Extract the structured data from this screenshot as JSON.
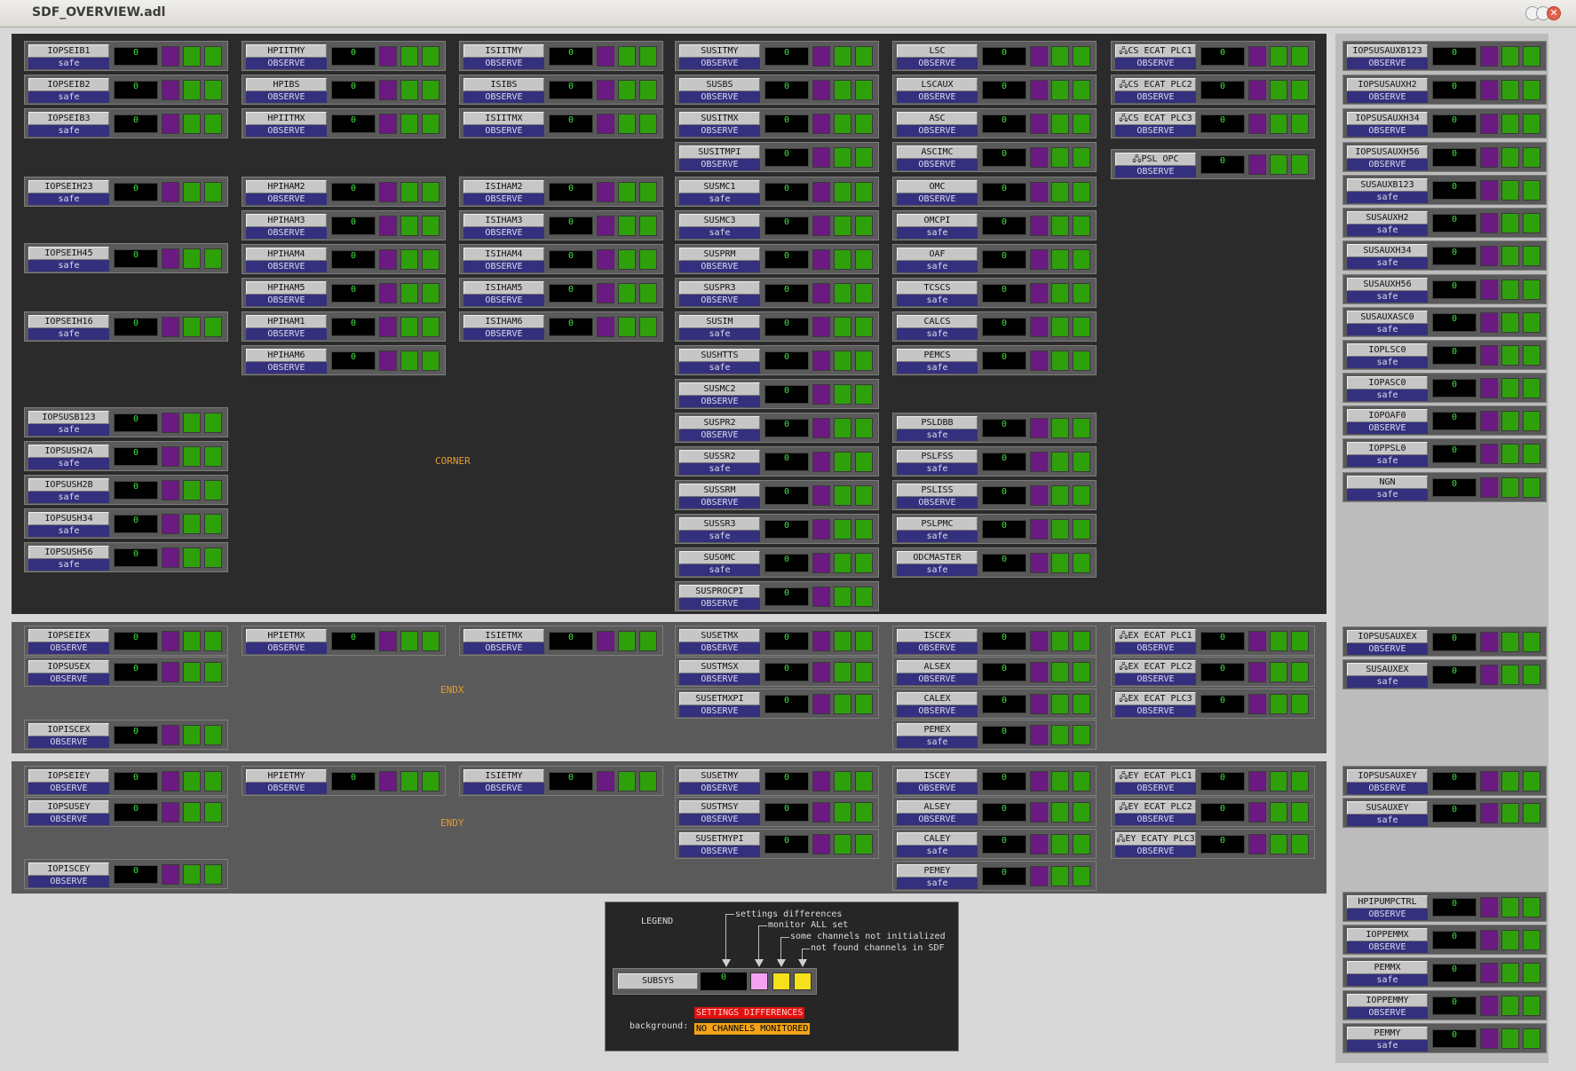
{
  "window": {
    "title": "SDF_OVERVIEW.adl"
  },
  "colors": {
    "purple": "#6b1a82",
    "green": "#2ea10a",
    "status_bg": "#34307e",
    "count_text": "#3fe33f"
  },
  "panels": {
    "corner": "CORNER",
    "endx": "ENDX",
    "endy": "ENDY"
  },
  "entries": [
    {
      "name": "IOPSEIB1",
      "status": "safe",
      "count": "0"
    },
    {
      "name": "IOPSEIB2",
      "status": "safe",
      "count": "0"
    },
    {
      "name": "IOPSEIB3",
      "status": "safe",
      "count": "0"
    },
    {
      "name": "IOPSEIH23",
      "status": "safe",
      "count": "0"
    },
    {
      "name": "IOPSEIH45",
      "status": "safe",
      "count": "0"
    },
    {
      "name": "IOPSEIH16",
      "status": "safe",
      "count": "0"
    },
    {
      "name": "IOPSUSB123",
      "status": "safe",
      "count": "0"
    },
    {
      "name": "IOPSUSH2A",
      "status": "safe",
      "count": "0"
    },
    {
      "name": "IOPSUSH2B",
      "status": "safe",
      "count": "0"
    },
    {
      "name": "IOPSUSH34",
      "status": "safe",
      "count": "0"
    },
    {
      "name": "IOPSUSH56",
      "status": "safe",
      "count": "0"
    },
    {
      "name": "HPIITMY",
      "status": "OBSERVE",
      "count": "0"
    },
    {
      "name": "HPIBS",
      "status": "OBSERVE",
      "count": "0"
    },
    {
      "name": "HPIITMX",
      "status": "OBSERVE",
      "count": "0"
    },
    {
      "name": "HPIHAM2",
      "status": "OBSERVE",
      "count": "0"
    },
    {
      "name": "HPIHAM3",
      "status": "OBSERVE",
      "count": "0"
    },
    {
      "name": "HPIHAM4",
      "status": "OBSERVE",
      "count": "0"
    },
    {
      "name": "HPIHAM5",
      "status": "OBSERVE",
      "count": "0"
    },
    {
      "name": "HPIHAM1",
      "status": "OBSERVE",
      "count": "0"
    },
    {
      "name": "HPIHAM6",
      "status": "OBSERVE",
      "count": "0"
    },
    {
      "name": "ISIITMY",
      "status": "OBSERVE",
      "count": "0"
    },
    {
      "name": "ISIBS",
      "status": "OBSERVE",
      "count": "0"
    },
    {
      "name": "ISIITMX",
      "status": "OBSERVE",
      "count": "0"
    },
    {
      "name": "ISIHAM2",
      "status": "OBSERVE",
      "count": "0"
    },
    {
      "name": "ISIHAM3",
      "status": "OBSERVE",
      "count": "0"
    },
    {
      "name": "ISIHAM4",
      "status": "OBSERVE",
      "count": "0"
    },
    {
      "name": "ISIHAM5",
      "status": "OBSERVE",
      "count": "0"
    },
    {
      "name": "ISIHAM6",
      "status": "OBSERVE",
      "count": "0"
    },
    {
      "name": "SUSITMY",
      "status": "OBSERVE",
      "count": "0"
    },
    {
      "name": "SUSBS",
      "status": "OBSERVE",
      "count": "0"
    },
    {
      "name": "SUSITMX",
      "status": "OBSERVE",
      "count": "0"
    },
    {
      "name": "SUSITMPI",
      "status": "OBSERVE",
      "count": "0"
    },
    {
      "name": "SUSMC1",
      "status": "safe",
      "count": "0"
    },
    {
      "name": "SUSMC3",
      "status": "safe",
      "count": "0"
    },
    {
      "name": "SUSPRM",
      "status": "OBSERVE",
      "count": "0"
    },
    {
      "name": "SUSPR3",
      "status": "OBSERVE",
      "count": "0"
    },
    {
      "name": "SUSIM",
      "status": "safe",
      "count": "0"
    },
    {
      "name": "SUSHTTS",
      "status": "safe",
      "count": "0"
    },
    {
      "name": "SUSMC2",
      "status": "OBSERVE",
      "count": "0"
    },
    {
      "name": "SUSPR2",
      "status": "OBSERVE",
      "count": "0"
    },
    {
      "name": "SUSSR2",
      "status": "safe",
      "count": "0"
    },
    {
      "name": "SUSSRM",
      "status": "OBSERVE",
      "count": "0"
    },
    {
      "name": "SUSSR3",
      "status": "safe",
      "count": "0"
    },
    {
      "name": "SUSOMC",
      "status": "safe",
      "count": "0"
    },
    {
      "name": "SUSPROCPI",
      "status": "OBSERVE",
      "count": "0"
    },
    {
      "name": "LSC",
      "status": "OBSERVE",
      "count": "0"
    },
    {
      "name": "LSCAUX",
      "status": "OBSERVE",
      "count": "0"
    },
    {
      "name": "ASC",
      "status": "OBSERVE",
      "count": "0"
    },
    {
      "name": "ASCIMC",
      "status": "OBSERVE",
      "count": "0"
    },
    {
      "name": "OMC",
      "status": "OBSERVE",
      "count": "0"
    },
    {
      "name": "OMCPI",
      "status": "safe",
      "count": "0"
    },
    {
      "name": "OAF",
      "status": "safe",
      "count": "0"
    },
    {
      "name": "TCSCS",
      "status": "safe",
      "count": "0"
    },
    {
      "name": "CALCS",
      "status": "safe",
      "count": "0"
    },
    {
      "name": "PEMCS",
      "status": "safe",
      "count": "0"
    },
    {
      "name": "PSLDBB",
      "status": "safe",
      "count": "0"
    },
    {
      "name": "PSLFSS",
      "status": "safe",
      "count": "0"
    },
    {
      "name": "PSLISS",
      "status": "OBSERVE",
      "count": "0"
    },
    {
      "name": "PSLPMC",
      "status": "safe",
      "count": "0"
    },
    {
      "name": "ODCMASTER",
      "status": "safe",
      "count": "0"
    },
    {
      "name": "CS ECAT PLC1",
      "status": "OBSERVE",
      "count": "0",
      "icon": true
    },
    {
      "name": "CS ECAT PLC2",
      "status": "OBSERVE",
      "count": "0",
      "icon": true
    },
    {
      "name": "CS ECAT PLC3",
      "status": "OBSERVE",
      "count": "0",
      "icon": true
    },
    {
      "name": "PSL OPC",
      "status": "OBSERVE",
      "count": "0",
      "icon": true
    },
    {
      "name": "IOPSEIEX",
      "status": "OBSERVE",
      "count": "0"
    },
    {
      "name": "IOPSUSEX",
      "status": "OBSERVE",
      "count": "0"
    },
    {
      "name": "IOPISCEX",
      "status": "OBSERVE",
      "count": "0"
    },
    {
      "name": "HPIETMX",
      "status": "OBSERVE",
      "count": "0"
    },
    {
      "name": "ISIETMX",
      "status": "OBSERVE",
      "count": "0"
    },
    {
      "name": "SUSETMX",
      "status": "OBSERVE",
      "count": "0"
    },
    {
      "name": "SUSTMSX",
      "status": "OBSERVE",
      "count": "0"
    },
    {
      "name": "SUSETMXPI",
      "status": "OBSERVE",
      "count": "0"
    },
    {
      "name": "ISCEX",
      "status": "OBSERVE",
      "count": "0"
    },
    {
      "name": "ALSEX",
      "status": "OBSERVE",
      "count": "0"
    },
    {
      "name": "CALEX",
      "status": "OBSERVE",
      "count": "0"
    },
    {
      "name": "PEMEX",
      "status": "safe",
      "count": "0"
    },
    {
      "name": "EX ECAT PLC1",
      "status": "OBSERVE",
      "count": "0",
      "icon": true
    },
    {
      "name": "EX ECAT PLC2",
      "status": "OBSERVE",
      "count": "0",
      "icon": true
    },
    {
      "name": "EX ECAT PLC3",
      "status": "OBSERVE",
      "count": "0",
      "icon": true
    },
    {
      "name": "IOPSEIEY",
      "status": "OBSERVE",
      "count": "0"
    },
    {
      "name": "IOPSUSEY",
      "status": "OBSERVE",
      "count": "0"
    },
    {
      "name": "IOPISCEY",
      "status": "OBSERVE",
      "count": "0"
    },
    {
      "name": "HPIETMY",
      "status": "OBSERVE",
      "count": "0"
    },
    {
      "name": "ISIETMY",
      "status": "OBSERVE",
      "count": "0"
    },
    {
      "name": "SUSETMY",
      "status": "OBSERVE",
      "count": "0"
    },
    {
      "name": "SUSTMSY",
      "status": "OBSERVE",
      "count": "0"
    },
    {
      "name": "SUSETMYPI",
      "status": "OBSERVE",
      "count": "0"
    },
    {
      "name": "ISCEY",
      "status": "OBSERVE",
      "count": "0"
    },
    {
      "name": "ALSEY",
      "status": "OBSERVE",
      "count": "0"
    },
    {
      "name": "CALEY",
      "status": "safe",
      "count": "0"
    },
    {
      "name": "PEMEY",
      "status": "safe",
      "count": "0"
    },
    {
      "name": "EY ECAT PLC1",
      "status": "OBSERVE",
      "count": "0",
      "icon": true
    },
    {
      "name": "EY ECAT PLC2",
      "status": "OBSERVE",
      "count": "0",
      "icon": true
    },
    {
      "name": "EY ECATY PLC3",
      "status": "OBSERVE",
      "count": "0",
      "icon": true
    },
    {
      "name": "IOPSUSAUXB123",
      "status": "OBSERVE",
      "count": "0"
    },
    {
      "name": "IOPSUSAUXH2",
      "status": "OBSERVE",
      "count": "0"
    },
    {
      "name": "IOPSUSAUXH34",
      "status": "OBSERVE",
      "count": "0"
    },
    {
      "name": "IOPSUSAUXH56",
      "status": "OBSERVE",
      "count": "0"
    },
    {
      "name": "SUSAUXB123",
      "status": "safe",
      "count": "0"
    },
    {
      "name": "SUSAUXH2",
      "status": "safe",
      "count": "0"
    },
    {
      "name": "SUSAUXH34",
      "status": "safe",
      "count": "0"
    },
    {
      "name": "SUSAUXH56",
      "status": "safe",
      "count": "0"
    },
    {
      "name": "SUSAUXASC0",
      "status": "safe",
      "count": "0"
    },
    {
      "name": "IOPLSC0",
      "status": "safe",
      "count": "0"
    },
    {
      "name": "IOPASC0",
      "status": "safe",
      "count": "0"
    },
    {
      "name": "IOPOAF0",
      "status": "OBSERVE",
      "count": "0"
    },
    {
      "name": "IOPPSL0",
      "status": "safe",
      "count": "0"
    },
    {
      "name": "NGN",
      "status": "safe",
      "count": "0"
    },
    {
      "name": "IOPSUSAUXEX",
      "status": "OBSERVE",
      "count": "0"
    },
    {
      "name": "SUSAUXEX",
      "status": "safe",
      "count": "0"
    },
    {
      "name": "IOPSUSAUXEY",
      "status": "OBSERVE",
      "count": "0"
    },
    {
      "name": "SUSAUXEY",
      "status": "safe",
      "count": "0"
    },
    {
      "name": "HPIPUMPCTRL",
      "status": "OBSERVE",
      "count": "0"
    },
    {
      "name": "IOPPEMMX",
      "status": "OBSERVE",
      "count": "0"
    },
    {
      "name": "PEMMX",
      "status": "safe",
      "count": "0"
    },
    {
      "name": "IOPPEMMY",
      "status": "OBSERVE",
      "count": "0"
    },
    {
      "name": "PEMMY",
      "status": "safe",
      "count": "0"
    }
  ],
  "legend": {
    "title": "LEGEND",
    "ann1": "settings differences",
    "ann2": "monitor ALL set",
    "ann3": "some channels not initialized",
    "ann4": "not found channels in SDF",
    "subsys": "SUBSYS",
    "count": "0",
    "background_label": "background:",
    "bg1": "SETTINGS DIFFERENCES",
    "bg2": "NO CHANNELS MONITORED",
    "colors": {
      "pink": "#f5a3f0",
      "yellow": "#f5e01a",
      "red": "#e01010",
      "orange": "#f3a31a"
    }
  }
}
